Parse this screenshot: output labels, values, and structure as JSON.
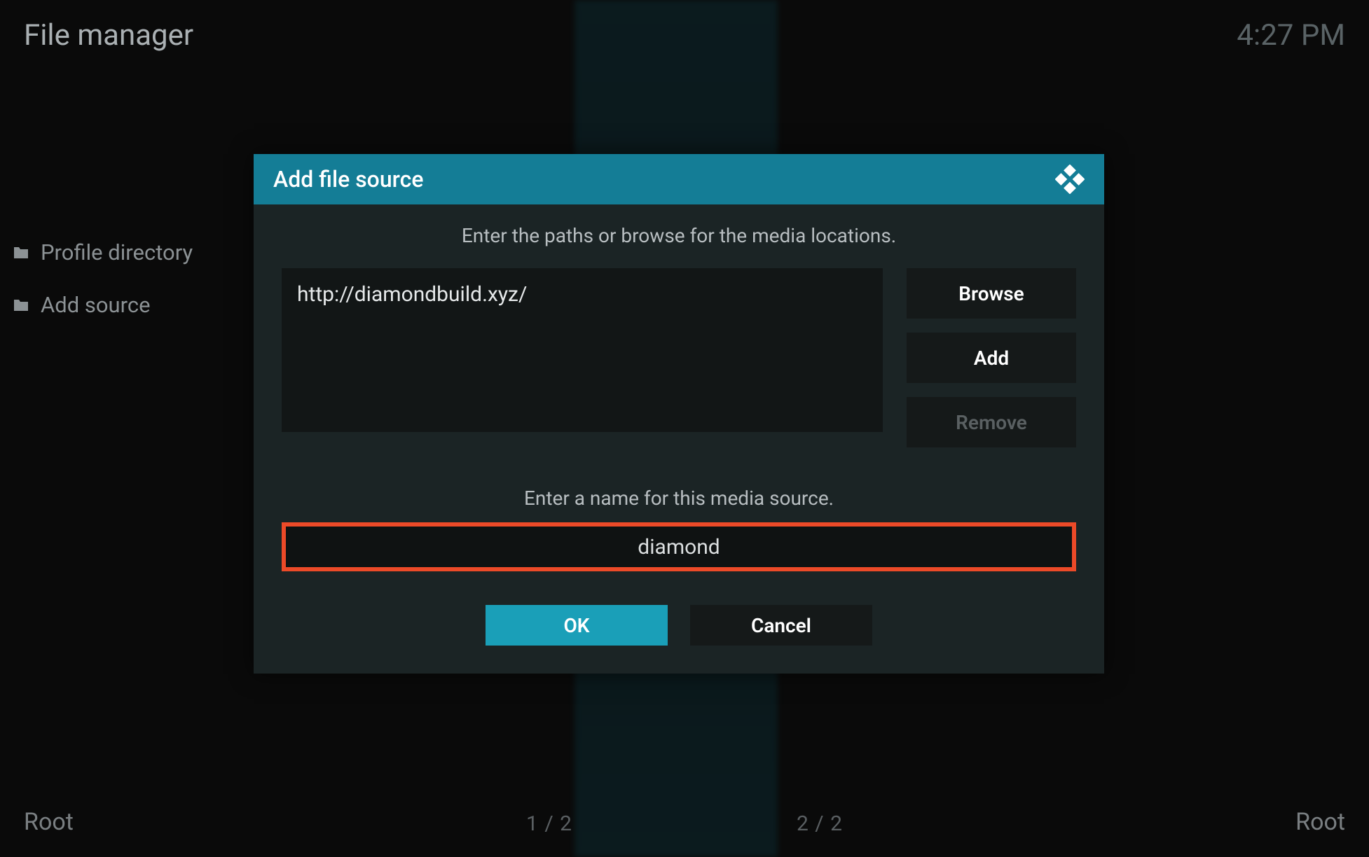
{
  "header": {
    "title": "File manager",
    "clock": "4:27 PM"
  },
  "sidebar": {
    "items": [
      {
        "label": "Profile directory"
      },
      {
        "label": "Add source"
      }
    ]
  },
  "dialog": {
    "title": "Add file source",
    "instruction_paths": "Enter the paths or browse for the media locations.",
    "path_value": "http://diamondbuild.xyz/",
    "buttons": {
      "browse": "Browse",
      "add": "Add",
      "remove": "Remove"
    },
    "instruction_name": "Enter a name for this media source.",
    "name_value": "diamond",
    "ok": "OK",
    "cancel": "Cancel"
  },
  "footer": {
    "left_root": "Root",
    "right_root": "Root",
    "pager_left": "1 / 2",
    "pager_right": "2 / 2"
  }
}
